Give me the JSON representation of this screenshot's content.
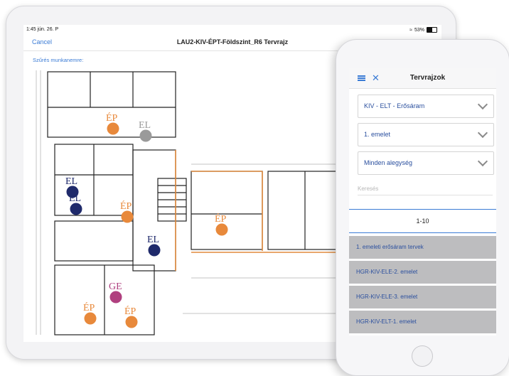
{
  "tablet": {
    "status": {
      "time": "1:45  jún. 26. P",
      "battery": "53%"
    },
    "nav": {
      "cancel": "Cancel",
      "title": "LAU2-KIV-ÉPT-Földszint_R6 Tervrajz"
    },
    "filter_link": "Szűrés munkanemre:",
    "markers": [
      {
        "label": "ÉP",
        "color": "#e8893b"
      },
      {
        "label": "EL",
        "color": "#9a9a9a"
      },
      {
        "label": "EL",
        "color": "#1f2a6b"
      },
      {
        "label": "EL",
        "color": "#1f2a6b"
      },
      {
        "label": "ÉP",
        "color": "#e8893b"
      },
      {
        "label": "ÉP",
        "color": "#e8893b"
      },
      {
        "label": "EL",
        "color": "#1f2a6b"
      },
      {
        "label": "GE",
        "color": "#b0407f"
      },
      {
        "label": "ÉP",
        "color": "#e8893b"
      },
      {
        "label": "ÉP",
        "color": "#e8893b"
      }
    ]
  },
  "phone": {
    "header": {
      "title": "Tervrajzok"
    },
    "selects": [
      {
        "label": "KIV  -  ELT  -  Erősáram"
      },
      {
        "label": "1. emelet"
      },
      {
        "label": "Minden alegység"
      }
    ],
    "search_placeholder": "Keresés",
    "pager": "1-10",
    "items": [
      {
        "label": "1. emeleti erősáram tervek"
      },
      {
        "label": "HGR-KIV-ELE-2. emelet"
      },
      {
        "label": "HGR-KIV-ELE-3. emelet"
      },
      {
        "label": "HGR-KIV-ELT-1. emelet"
      }
    ]
  },
  "colors": {
    "accent": "#3a7bd5",
    "orange": "#e8893b",
    "navy": "#1f2a6b",
    "purple": "#b0407f",
    "gray": "#9a9a9a"
  }
}
